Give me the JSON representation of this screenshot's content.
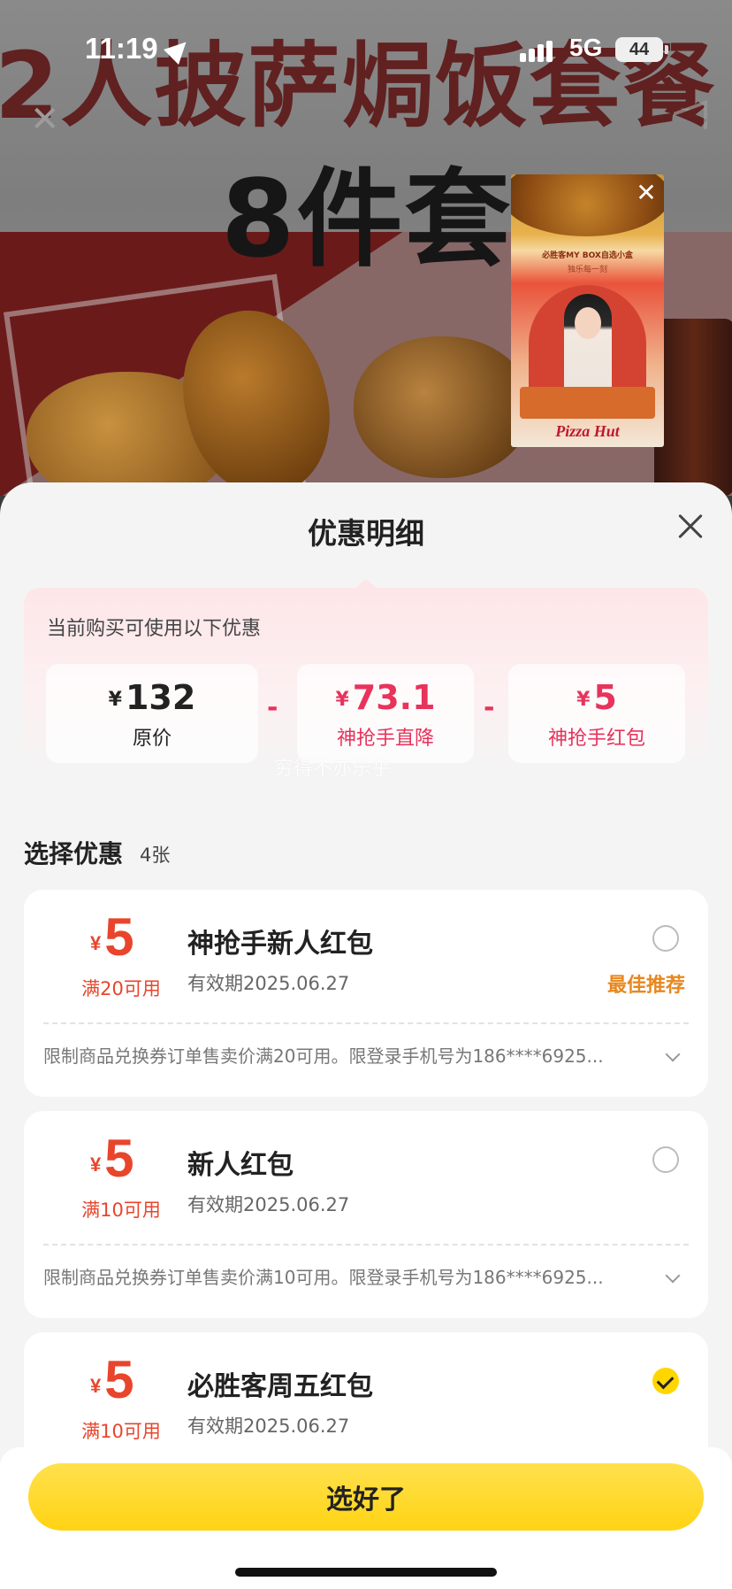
{
  "status_bar": {
    "time": "11:19",
    "network": "5G",
    "battery": "44"
  },
  "background_promo": {
    "headline_1": "2人披萨焗饭套餐",
    "headline_2": "8件套"
  },
  "video_ad": {
    "headline": "必胜客MY BOX自选小盒",
    "subline": "独乐每一刻",
    "brand": "Pizza Hut"
  },
  "sheet": {
    "title": "优惠明细",
    "summary": {
      "label": "当前购买可使用以下优惠",
      "currency": "¥",
      "original": {
        "amount": "132",
        "caption": "原价"
      },
      "discount": {
        "amount": "73.1",
        "caption": "神抢手直降"
      },
      "redpacket": {
        "amount": "5",
        "caption": "神抢手红包"
      },
      "operator": "-"
    },
    "watermark": "穷得不亦乐乎",
    "choose": {
      "title": "选择优惠",
      "count": "4张"
    },
    "coupons": [
      {
        "currency": "¥",
        "amount": "5",
        "condition": "满20可用",
        "title": "神抢手新人红包",
        "validity": "有效期2025.06.27",
        "tag": "最佳推荐",
        "selected": false,
        "description": "限制商品兑换券订单售卖价满20可用。限登录手机号为186****6925..."
      },
      {
        "currency": "¥",
        "amount": "5",
        "condition": "满10可用",
        "title": "新人红包",
        "validity": "有效期2025.06.27",
        "tag": "",
        "selected": false,
        "description": "限制商品兑换券订单售卖价满10可用。限登录手机号为186****6925..."
      },
      {
        "currency": "¥",
        "amount": "5",
        "condition": "满10可用",
        "title": "必胜客周五红包",
        "validity": "有效期2025.06.27",
        "tag": "",
        "selected": true,
        "description": ""
      }
    ],
    "confirm_label": "选好了"
  },
  "colors": {
    "accent_red": "#e8452c",
    "price_pink": "#e8335b",
    "confirm_yellow": "#ffd314",
    "best_orange": "#e8871e"
  }
}
